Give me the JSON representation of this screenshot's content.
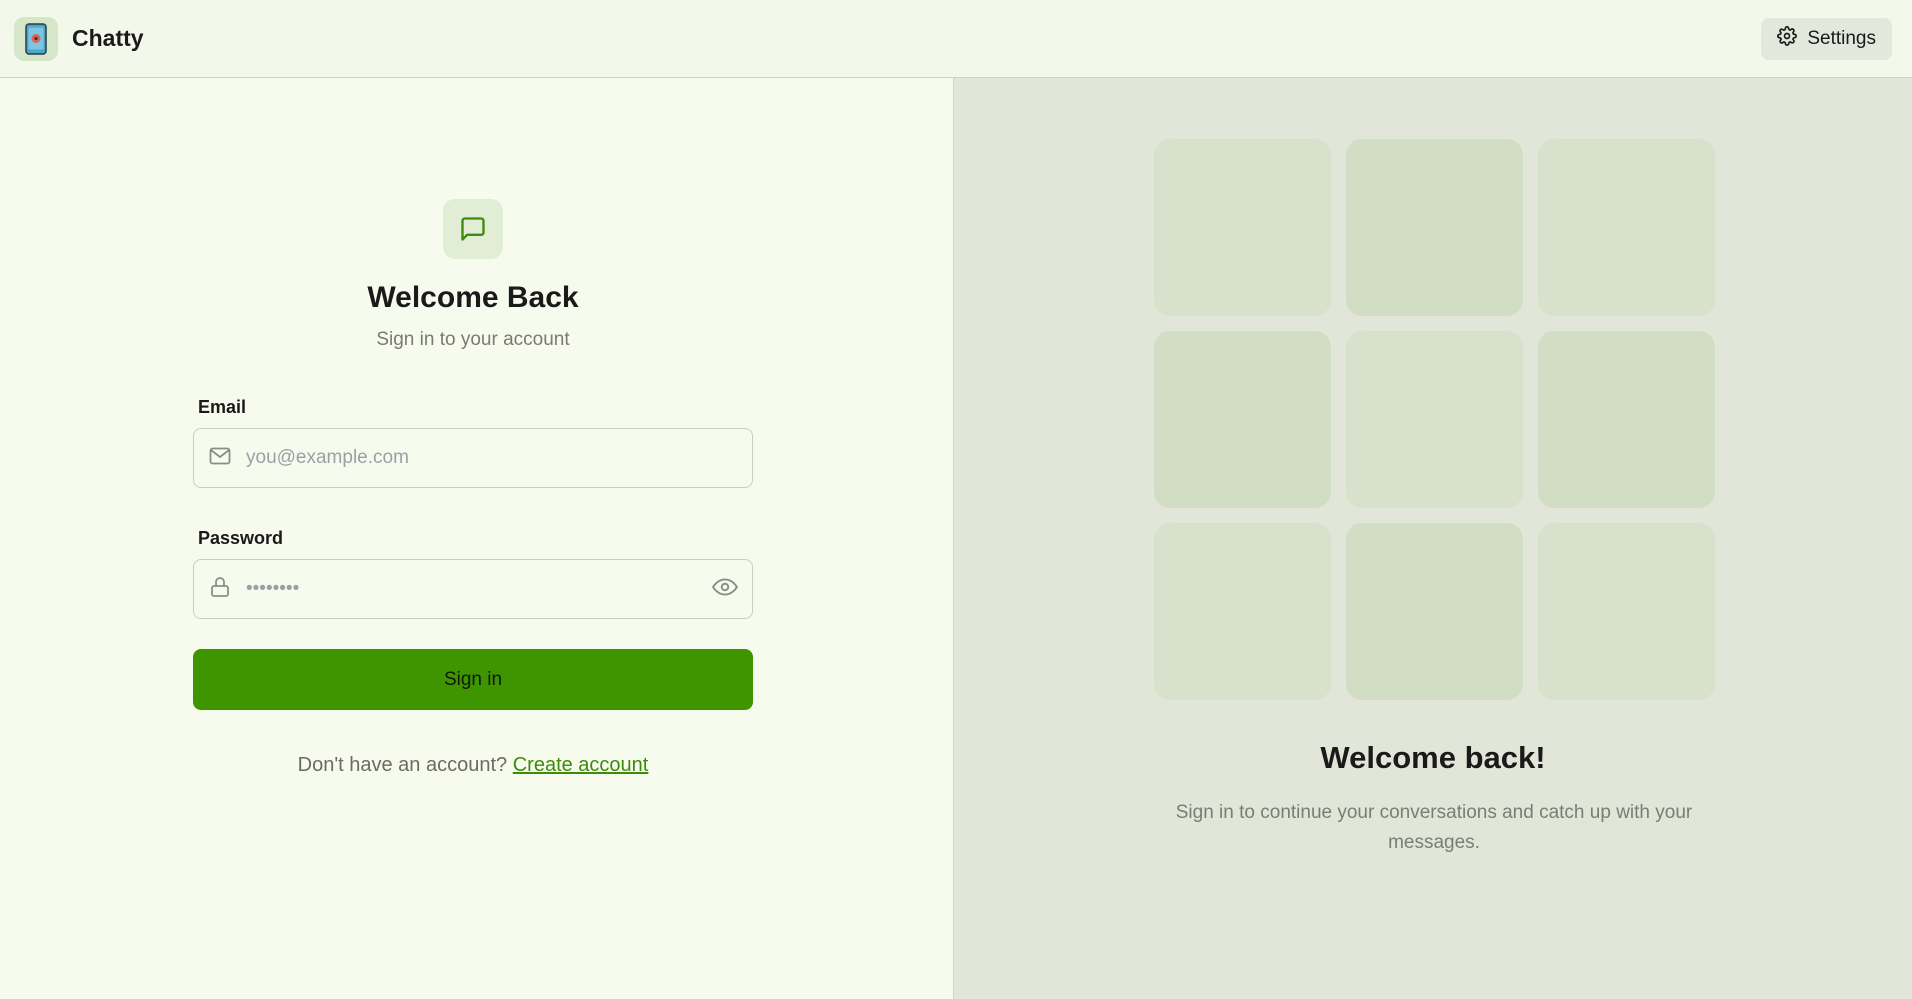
{
  "header": {
    "app_name": "Chatty",
    "settings_label": "Settings"
  },
  "login": {
    "title": "Welcome Back",
    "subtitle": "Sign in to your account",
    "email_label": "Email",
    "email_placeholder": "you@example.com",
    "password_label": "Password",
    "password_value": "••••••••",
    "submit_label": "Sign in",
    "signup_prompt": "Don't have an account?",
    "signup_link": "Create account"
  },
  "promo": {
    "title": "Welcome back!",
    "description": "Sign in to continue your conversations and catch up with your messages."
  },
  "icons": {
    "logo": "phone-app-icon",
    "settings": "gear-icon",
    "chat": "chat-bubble-icon",
    "email": "mail-icon",
    "password": "lock-icon",
    "toggle_password": "eye-icon"
  },
  "colors": {
    "accent": "#3f9500",
    "link": "#3f8a0c",
    "background": "#f7fbee",
    "panel": "#e2e6d8"
  }
}
